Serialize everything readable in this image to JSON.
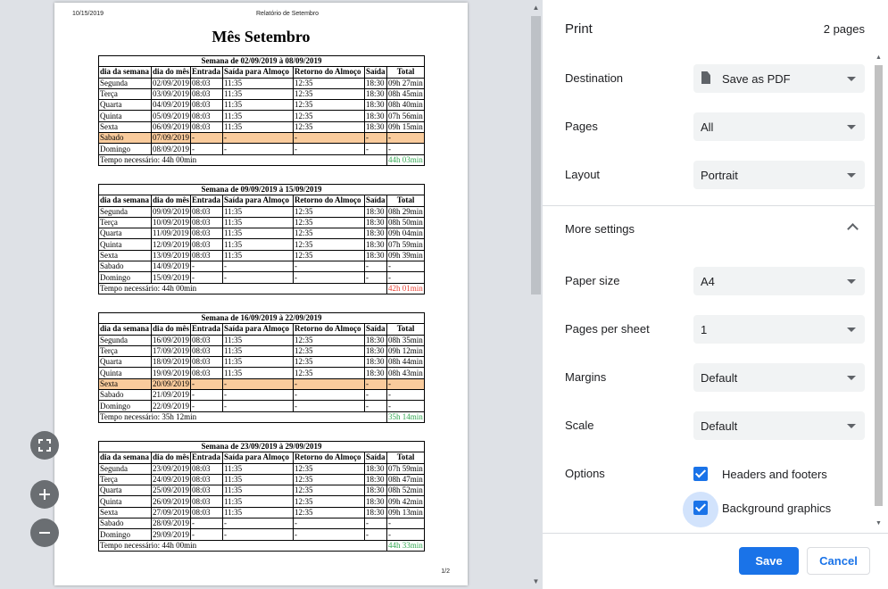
{
  "document": {
    "header_date": "10/15/2019",
    "header_title": "Relatório de Setembro",
    "title": "Mês Setembro",
    "page_number": "1/2",
    "columns": [
      "dia da semana",
      "dia do mês",
      "Entrada",
      "Saída para Almoço",
      "Retorno do Almoço",
      "Saída",
      "Total"
    ],
    "weeks": [
      {
        "title": "Semana de 02/09/2019 à 08/09/2019",
        "rows": [
          {
            "cells": [
              "Segunda",
              "02/09/2019",
              "08:03",
              "11:35",
              "12:35",
              "18:30",
              "09h 27min"
            ],
            "highlight": false
          },
          {
            "cells": [
              "Terça",
              "03/09/2019",
              "08:03",
              "11:35",
              "12:35",
              "18:30",
              "08h 45min"
            ],
            "highlight": false
          },
          {
            "cells": [
              "Quarta",
              "04/09/2019",
              "08:03",
              "11:35",
              "12:35",
              "18:30",
              "08h 40min"
            ],
            "highlight": false
          },
          {
            "cells": [
              "Quinta",
              "05/09/2019",
              "08:03",
              "11:35",
              "12:35",
              "18:30",
              "07h 56min"
            ],
            "highlight": false
          },
          {
            "cells": [
              "Sexta",
              "06/09/2019",
              "08:03",
              "11:35",
              "12:35",
              "18:30",
              "09h 15min"
            ],
            "highlight": false
          },
          {
            "cells": [
              "Sabado",
              "07/09/2019",
              "-",
              "-",
              "-",
              "-",
              "-"
            ],
            "highlight": true
          },
          {
            "cells": [
              "Domingo",
              "08/09/2019",
              "-",
              "-",
              "-",
              "-",
              "-"
            ],
            "highlight": false
          }
        ],
        "required": "Tempo necessário: 44h 00min",
        "total": "44h 03min",
        "total_status": "ok"
      },
      {
        "title": "Semana de 09/09/2019 à 15/09/2019",
        "rows": [
          {
            "cells": [
              "Segunda",
              "09/09/2019",
              "08:03",
              "11:35",
              "12:35",
              "18:30",
              "08h 29min"
            ],
            "highlight": false
          },
          {
            "cells": [
              "Terça",
              "10/09/2019",
              "08:03",
              "11:35",
              "12:35",
              "18:30",
              "08h 50min"
            ],
            "highlight": false
          },
          {
            "cells": [
              "Quarta",
              "11/09/2019",
              "08:03",
              "11:35",
              "12:35",
              "18:30",
              "09h 04min"
            ],
            "highlight": false
          },
          {
            "cells": [
              "Quinta",
              "12/09/2019",
              "08:03",
              "11:35",
              "12:35",
              "18:30",
              "07h 59min"
            ],
            "highlight": false
          },
          {
            "cells": [
              "Sexta",
              "13/09/2019",
              "08:03",
              "11:35",
              "12:35",
              "18:30",
              "09h 39min"
            ],
            "highlight": false
          },
          {
            "cells": [
              "Sabado",
              "14/09/2019",
              "-",
              "-",
              "-",
              "-",
              "-"
            ],
            "highlight": false
          },
          {
            "cells": [
              "Domingo",
              "15/09/2019",
              "-",
              "-",
              "-",
              "-",
              "-"
            ],
            "highlight": false
          }
        ],
        "required": "Tempo necessário: 44h 00min",
        "total": "42h 01min",
        "total_status": "bad"
      },
      {
        "title": "Semana de 16/09/2019 à 22/09/2019",
        "rows": [
          {
            "cells": [
              "Segunda",
              "16/09/2019",
              "08:03",
              "11:35",
              "12:35",
              "18:30",
              "08h 35min"
            ],
            "highlight": false
          },
          {
            "cells": [
              "Terça",
              "17/09/2019",
              "08:03",
              "11:35",
              "12:35",
              "18:30",
              "09h 12min"
            ],
            "highlight": false
          },
          {
            "cells": [
              "Quarta",
              "18/09/2019",
              "08:03",
              "11:35",
              "12:35",
              "18:30",
              "08h 44min"
            ],
            "highlight": false
          },
          {
            "cells": [
              "Quinta",
              "19/09/2019",
              "08:03",
              "11:35",
              "12:35",
              "18:30",
              "08h 43min"
            ],
            "highlight": false
          },
          {
            "cells": [
              "Sexta",
              "20/09/2019",
              "-",
              "-",
              "-",
              "-",
              "-"
            ],
            "highlight": true
          },
          {
            "cells": [
              "Sabado",
              "21/09/2019",
              "-",
              "-",
              "-",
              "-",
              "-"
            ],
            "highlight": false
          },
          {
            "cells": [
              "Domingo",
              "22/09/2019",
              "-",
              "-",
              "-",
              "-",
              "-"
            ],
            "highlight": false
          }
        ],
        "required": "Tempo necessário: 35h 12min",
        "total": "35h 14min",
        "total_status": "ok"
      },
      {
        "title": "Semana de 23/09/2019 à 29/09/2019",
        "rows": [
          {
            "cells": [
              "Segunda",
              "23/09/2019",
              "08:03",
              "11:35",
              "12:35",
              "18:30",
              "07h 59min"
            ],
            "highlight": false
          },
          {
            "cells": [
              "Terça",
              "24/09/2019",
              "08:03",
              "11:35",
              "12:35",
              "18:30",
              "08h 47min"
            ],
            "highlight": false
          },
          {
            "cells": [
              "Quarta",
              "25/09/2019",
              "08:03",
              "11:35",
              "12:35",
              "18:30",
              "08h 52min"
            ],
            "highlight": false
          },
          {
            "cells": [
              "Quinta",
              "26/09/2019",
              "08:03",
              "11:35",
              "12:35",
              "18:30",
              "09h 42min"
            ],
            "highlight": false
          },
          {
            "cells": [
              "Sexta",
              "27/09/2019",
              "08:03",
              "11:35",
              "12:35",
              "18:30",
              "09h 13min"
            ],
            "highlight": false
          },
          {
            "cells": [
              "Sabado",
              "28/09/2019",
              "-",
              "-",
              "-",
              "-",
              "-"
            ],
            "highlight": false
          },
          {
            "cells": [
              "Domingo",
              "29/09/2019",
              "-",
              "-",
              "-",
              "-",
              "-"
            ],
            "highlight": false
          }
        ],
        "required": "Tempo necessário: 44h 00min",
        "total": "44h 33min",
        "total_status": "ok"
      }
    ]
  },
  "zoom_controls": {
    "fit_icon": "fit-to-page-icon",
    "zoom_in_icon": "zoom-in-icon",
    "zoom_out_icon": "zoom-out-icon"
  },
  "print": {
    "title": "Print",
    "page_count": "2 pages",
    "destination": {
      "label": "Destination",
      "value": "Save as PDF",
      "icon": "file-icon"
    },
    "pages": {
      "label": "Pages",
      "value": "All"
    },
    "layout": {
      "label": "Layout",
      "value": "Portrait"
    },
    "more_settings": {
      "label": "More settings",
      "icon": "chevron-up-icon"
    },
    "paper_size": {
      "label": "Paper size",
      "value": "A4"
    },
    "pages_per_sheet": {
      "label": "Pages per sheet",
      "value": "1"
    },
    "margins": {
      "label": "Margins",
      "value": "Default"
    },
    "scale": {
      "label": "Scale",
      "value": "Default"
    },
    "options": {
      "label": "Options",
      "headers_footers": {
        "label": "Headers and footers",
        "checked": true
      },
      "background_graphics": {
        "label": "Background graphics",
        "checked": true
      }
    },
    "save_label": "Save",
    "cancel_label": "Cancel"
  },
  "colors": {
    "accent": "#1a73e8",
    "highlight_row": "#f9cb9c",
    "total_ok": "#34a853",
    "total_bad": "#ea4335"
  }
}
